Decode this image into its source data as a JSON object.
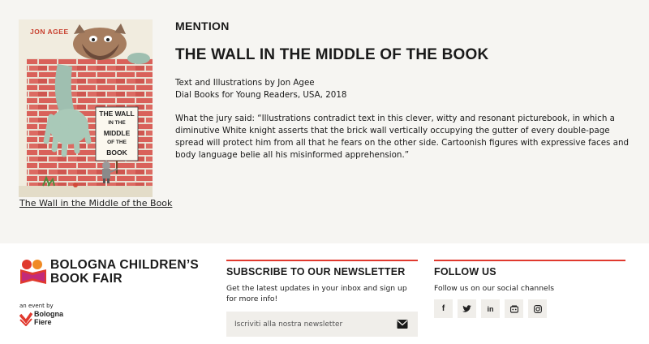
{
  "award": {
    "mention_label": "MENTION",
    "title": "THE WALL IN THE MIDDLE OF THE BOOK",
    "credits_line1": "Text and Illustrations by Jon Agee",
    "credits_line2": "Dial Books for Young Readers, USA, 2018",
    "jury_text": "What the jury said: “Illustrations contradict text in this clever, witty and resonant picturebook, in which a diminutive White knight asserts that the brick wall vertically occupying the gutter of every double-page spread will protect him from all that he fears on the other side. Cartoonish figures with expressive faces and body language belie all his misinformed apprehension.”",
    "cover": {
      "author": "JON AGEE",
      "sign_line1": "THE WALL",
      "sign_line2": "IN THE",
      "sign_line3": "MIDDLE",
      "sign_line4": "OF THE",
      "sign_line5": "BOOK",
      "caption_link": "The Wall in the Middle of the Book"
    }
  },
  "footer": {
    "brand_line1": "BOLOGNA CHILDREN’S",
    "brand_line2": "BOOK FAIR",
    "event_by": "an event by",
    "bf_line1": "Bologna",
    "bf_line2": "Fiere",
    "newsletter": {
      "heading": "SUBSCRIBE TO OUR NEWSLETTER",
      "text": "Get the latest updates in your inbox and sign up for more info!",
      "placeholder": "Iscriviti alla nostra newsletter"
    },
    "follow": {
      "heading": "FOLLOW US",
      "text": "Follow us on our social channels",
      "icons": [
        "facebook-icon",
        "twitter-icon",
        "linkedin-icon",
        "youtube-icon",
        "instagram-icon"
      ]
    }
  },
  "colors": {
    "accent": "#e0392e",
    "top_bg": "#f6f5f2",
    "field_bg": "#f0eeea",
    "brick": "#d9615a"
  }
}
